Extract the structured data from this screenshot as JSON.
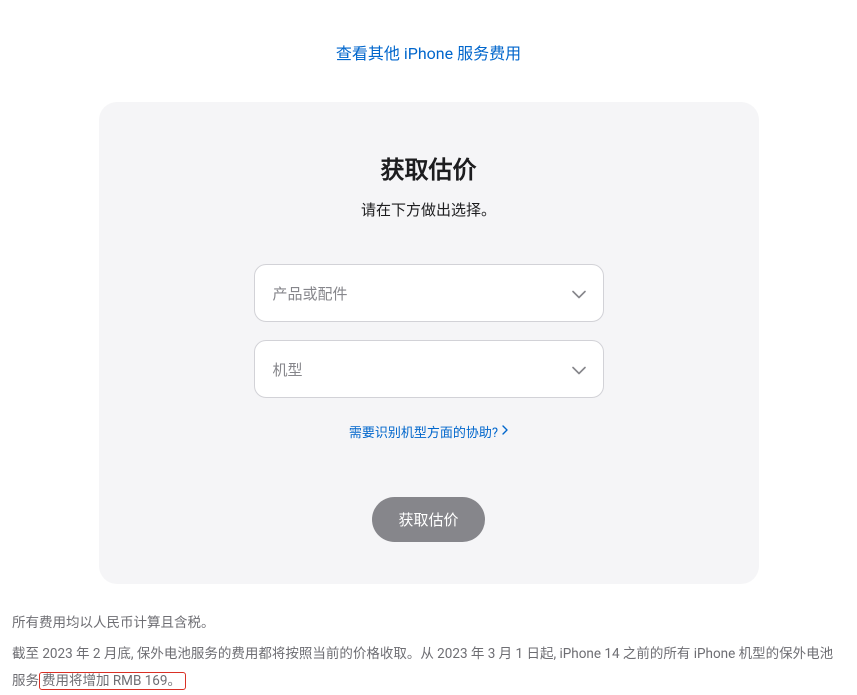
{
  "topLink": "查看其他 iPhone 服务费用",
  "card": {
    "title": "获取估价",
    "subtitle": "请在下方做出选择。",
    "select1Placeholder": "产品或配件",
    "select2Placeholder": "机型",
    "helpText": "需要识别机型方面的协助?",
    "submitLabel": "获取估价"
  },
  "footer": {
    "line1": "所有费用均以人民币计算且含税。",
    "line2Part1": "截至 2023 年 2 月底, 保外电池服务的费用都将按照当前的价格收取。从 2023 年 3 月 1 日起, iPhone 14 之前的所有 iPhone 机型的保外电池服务",
    "line2Highlight": "费用将增加 RMB 169。"
  }
}
